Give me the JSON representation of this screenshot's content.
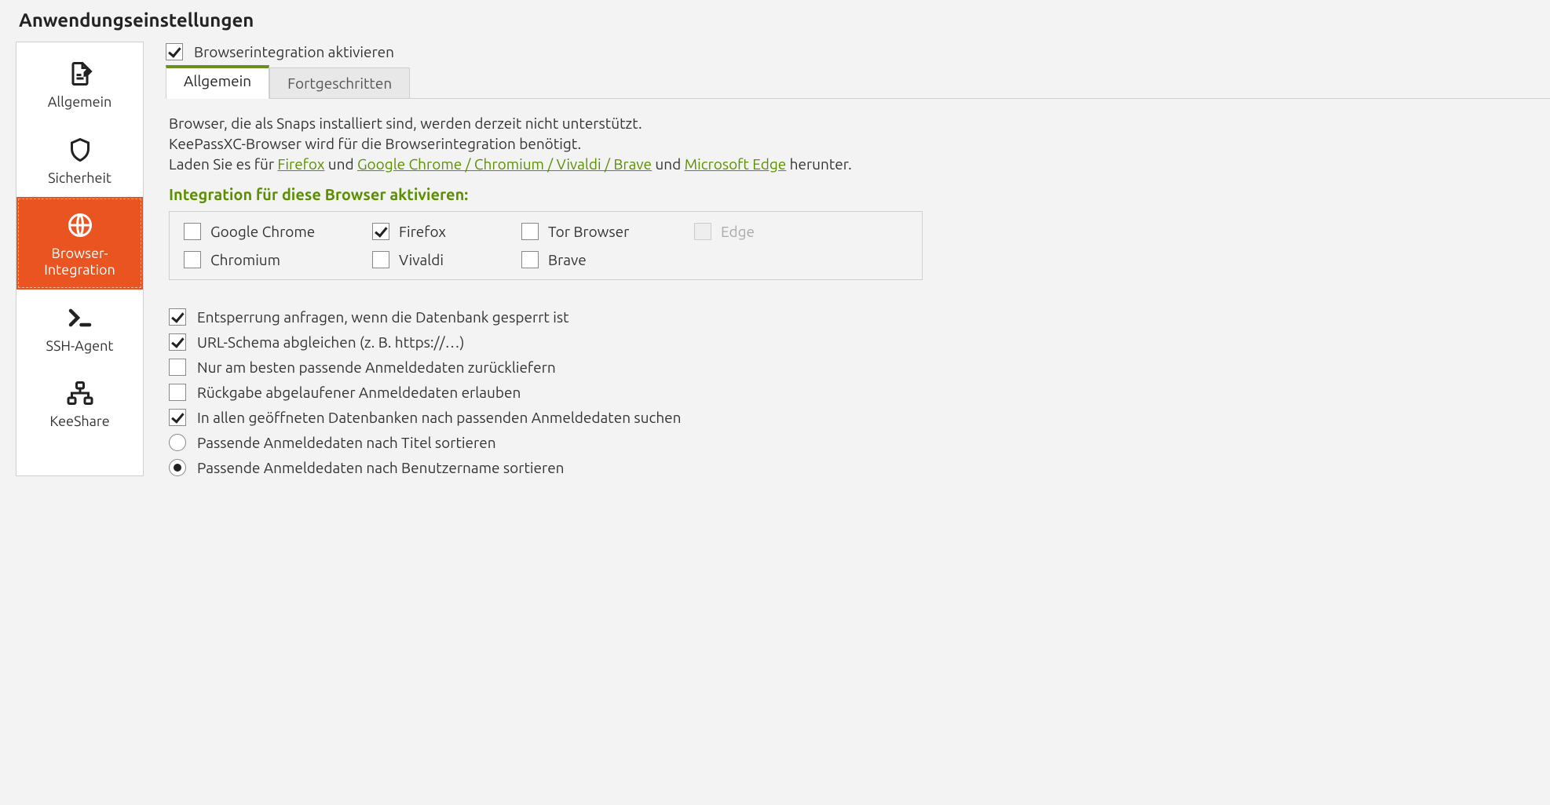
{
  "title": "Anwendungseinstellungen",
  "sidebar": {
    "items": [
      {
        "label": "Allgemein"
      },
      {
        "label": "Sicherheit"
      },
      {
        "label": "Browser-\nIntegration"
      },
      {
        "label": "SSH-Agent"
      },
      {
        "label": "KeeShare"
      }
    ]
  },
  "enable": {
    "label": "Browserintegration aktivieren"
  },
  "tabs": {
    "general": "Allgemein",
    "advanced": "Fortgeschritten"
  },
  "info": {
    "snaps": "Browser, die als Snaps installiert sind, werden derzeit nicht unterstützt.",
    "need": "KeePassXC-Browser wird für die Browserintegration benötigt.",
    "download_prefix": "Laden Sie es für ",
    "firefox": "Firefox",
    "and1": " und ",
    "chrome": "Google Chrome / Chromium / Vivaldi / Brave",
    "and2": " und ",
    "edge": "Microsoft Edge",
    "suffix": " herunter."
  },
  "section_head": "Integration für diese Browser aktivieren:",
  "browsers": {
    "chrome": "Google Chrome",
    "firefox": "Firefox",
    "tor": "Tor Browser",
    "edge": "Edge",
    "chromium": "Chromium",
    "vivaldi": "Vivaldi",
    "brave": "Brave"
  },
  "options": {
    "unlock": "Entsperrung anfragen, wenn die Datenbank gesperrt ist",
    "urlscheme": "URL-Schema abgleichen (z. B. https://…)",
    "bestonly": "Nur am besten passende Anmeldedaten zurückliefern",
    "expired": "Rückgabe abgelaufener Anmeldedaten erlauben",
    "allDbs": "In allen geöffneten Datenbanken nach passenden Anmeldedaten suchen",
    "sortTitle": "Passende Anmeldedaten nach Titel sortieren",
    "sortUser": "Passende Anmeldedaten nach Benutzername sortieren"
  }
}
